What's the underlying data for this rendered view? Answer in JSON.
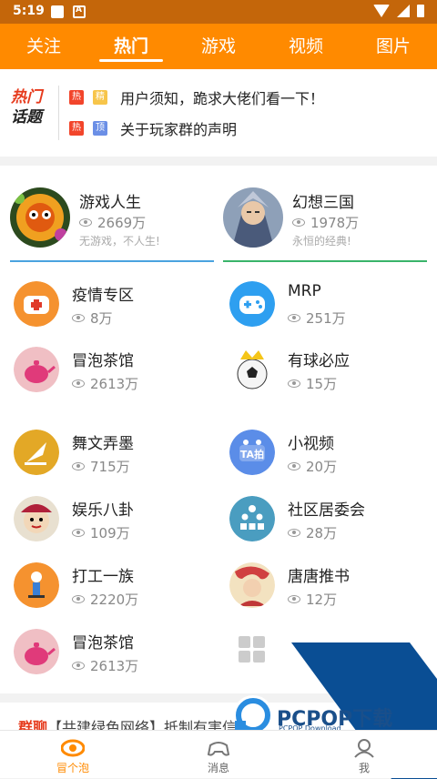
{
  "status_bar": {
    "time": "5:19"
  },
  "top_tabs": [
    "关注",
    "热门",
    "游戏",
    "视频",
    "图片"
  ],
  "hot_topics": {
    "logo_line1": "热门",
    "logo_line2": "话题",
    "items": [
      {
        "tags": [
          "热",
          "精"
        ],
        "text": "用户须知，跪求大佬们看一下！"
      },
      {
        "tags": [
          "热",
          "顶"
        ],
        "text": "关于玩家群的声明"
      }
    ]
  },
  "featured": [
    {
      "name": "游戏人生",
      "views": "2669万",
      "slogan": "无游戏，不人生!",
      "line_color": "#4aa3df"
    },
    {
      "name": "幻想三国",
      "views": "1978万",
      "slogan": "永恒的经典!",
      "line_color": "#39b46a"
    }
  ],
  "groups_left": [
    {
      "name": "疫情专区",
      "views": "8万",
      "icon": "mask-icon"
    },
    {
      "name": "冒泡茶馆",
      "views": "2613万",
      "icon": "teapot-icon"
    },
    {
      "name": "舞文弄墨",
      "views": "715万",
      "icon": "quill-icon"
    },
    {
      "name": "娱乐八卦",
      "views": "109万",
      "icon": "opera-mask-icon"
    },
    {
      "name": "打工一族",
      "views": "2220万",
      "icon": "worker-icon"
    },
    {
      "name": "冒泡茶馆",
      "views": "2613万",
      "icon": "teapot-icon"
    }
  ],
  "groups_right": [
    {
      "name": "MRP",
      "views": "251万",
      "icon": "gamepad-icon"
    },
    {
      "name": "有球必应",
      "views": "15万",
      "icon": "soccer-ball-icon"
    },
    {
      "name": "小视频",
      "views": "20万",
      "icon": "ta-video-icon"
    },
    {
      "name": "社区居委会",
      "views": "28万",
      "icon": "community-icon"
    },
    {
      "name": "唐唐推书",
      "views": "12万",
      "icon": "book-girl-icon"
    }
  ],
  "partial_text": {
    "prefix": "群聊",
    "body": "【共建绿色网络】抵制有害信息"
  },
  "watermark": {
    "brand": "PCPOP下载",
    "sub": "PCPOP Download"
  },
  "bottom_tabs": [
    "冒个泡",
    "消息",
    "我"
  ]
}
